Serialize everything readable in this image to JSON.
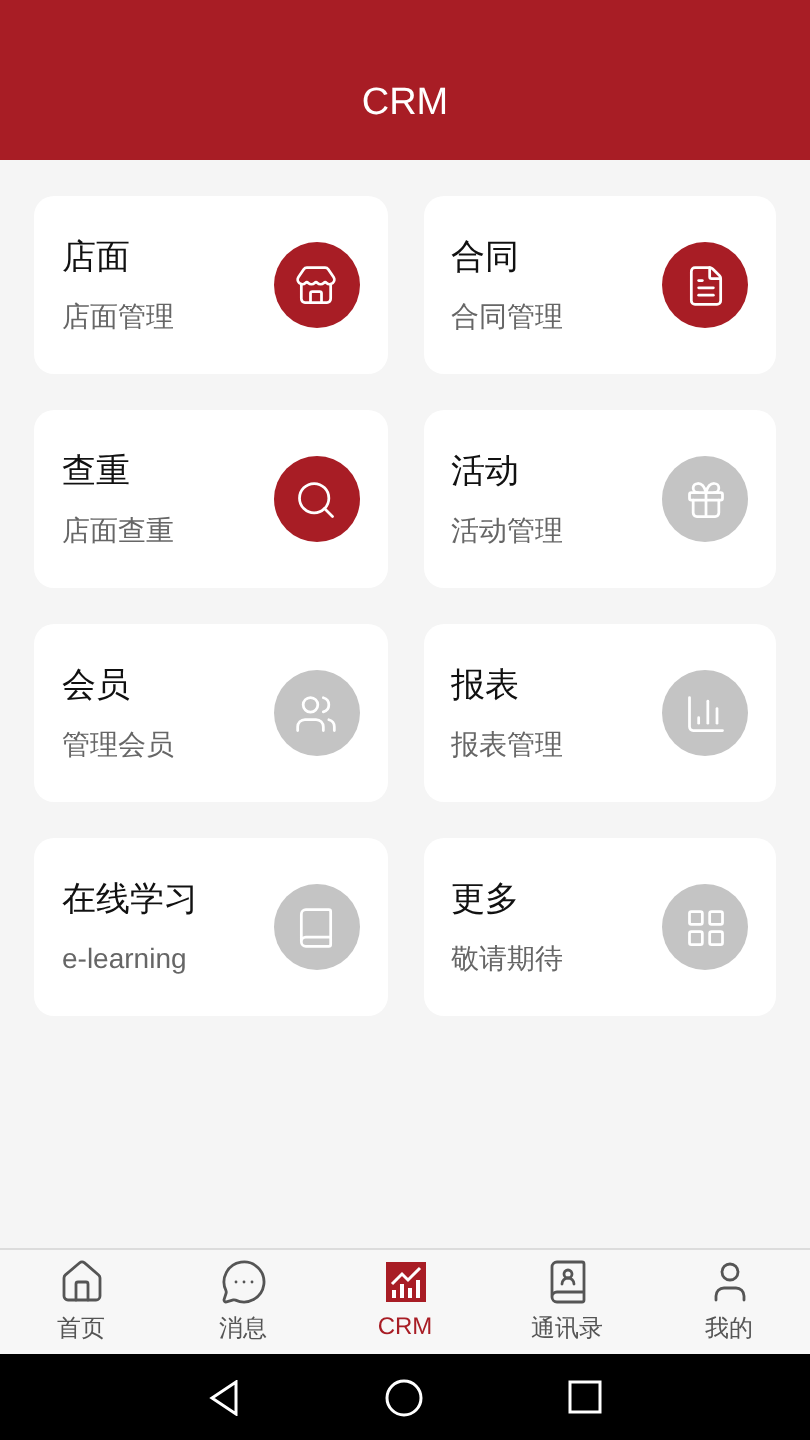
{
  "header": {
    "title": "CRM"
  },
  "tiles": [
    {
      "title": "店面",
      "subtitle": "店面管理",
      "enabled": true
    },
    {
      "title": "合同",
      "subtitle": "合同管理",
      "enabled": true
    },
    {
      "title": "查重",
      "subtitle": "店面查重",
      "enabled": true
    },
    {
      "title": "活动",
      "subtitle": "活动管理",
      "enabled": false
    },
    {
      "title": "会员",
      "subtitle": "管理会员",
      "enabled": false
    },
    {
      "title": "报表",
      "subtitle": "报表管理",
      "enabled": false
    },
    {
      "title": "在线学习",
      "subtitle": "e-learning",
      "enabled": false
    },
    {
      "title": "更多",
      "subtitle": "敬请期待",
      "enabled": false
    }
  ],
  "tab_bar": [
    {
      "label": "首页",
      "selected": false
    },
    {
      "label": "消息",
      "selected": false
    },
    {
      "label": "CRM",
      "selected": true
    },
    {
      "label": "通讯录",
      "selected": false
    },
    {
      "label": "我的",
      "selected": false
    }
  ]
}
